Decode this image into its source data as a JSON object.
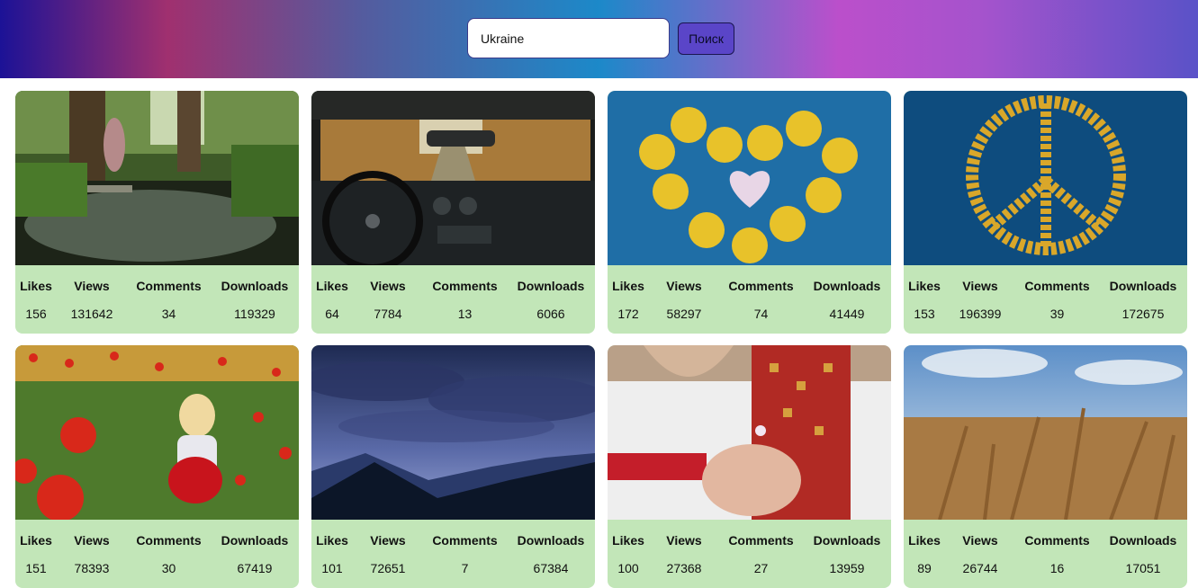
{
  "search": {
    "value": "Ukraine",
    "button_label": "Поиск"
  },
  "stat_labels": {
    "likes": "Likes",
    "views": "Views",
    "comments": "Comments",
    "downloads": "Downloads"
  },
  "cards": [
    {
      "likes": "156",
      "views": "131642",
      "comments": "34",
      "downloads": "119329"
    },
    {
      "likes": "64",
      "views": "7784",
      "comments": "13",
      "downloads": "6066"
    },
    {
      "likes": "172",
      "views": "58297",
      "comments": "74",
      "downloads": "41449"
    },
    {
      "likes": "153",
      "views": "196399",
      "comments": "39",
      "downloads": "172675"
    },
    {
      "likes": "151",
      "views": "78393",
      "comments": "30",
      "downloads": "67419"
    },
    {
      "likes": "101",
      "views": "72651",
      "comments": "7",
      "downloads": "67384"
    },
    {
      "likes": "100",
      "views": "27368",
      "comments": "27",
      "downloads": "13959"
    },
    {
      "likes": "89",
      "views": "26744",
      "comments": "16",
      "downloads": "17051"
    }
  ],
  "colors": {
    "card_background": "#c2e6b8",
    "search_button": "#5a45c8"
  }
}
